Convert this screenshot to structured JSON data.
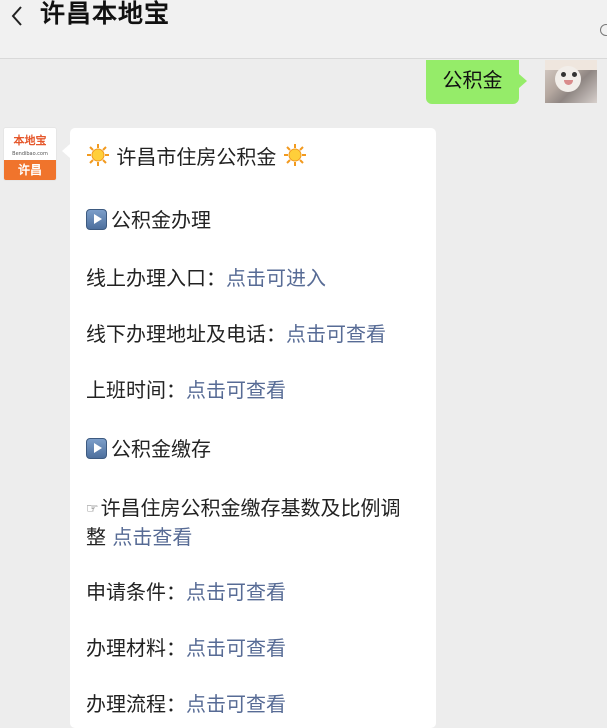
{
  "header": {
    "title": "许昌本地宝",
    "back_icon": "chevron-left-icon",
    "more_icon": "more-icon"
  },
  "outgoing": {
    "text": "公积金",
    "bubble_color": "#95ec69"
  },
  "bot": {
    "logo_name": "本地宝",
    "logo_url": "Bendibao.com",
    "logo_city": "许昌",
    "brand_color": "#f0742c"
  },
  "message": {
    "heading": "许昌市住房公积金",
    "section1_title": "公积金办理",
    "rows": [
      {
        "label": "线上办理入口：",
        "link": "点击可进入"
      },
      {
        "label": "线下办理地址及电话：",
        "link": "点击可查看"
      },
      {
        "label": "上班时间：",
        "link": "点击可查看"
      }
    ],
    "section2_title": "公积金缴存",
    "item_line1": "许昌住房公积金缴存基数及比例调",
    "item_line2": "整",
    "item_link": "点击查看",
    "rows2": [
      {
        "label": "申请条件：",
        "link": "点击可查看"
      },
      {
        "label": "办理材料：",
        "link": "点击可查看"
      },
      {
        "label": "办理流程：",
        "link": "点击可查看"
      }
    ],
    "link_color": "#576b95"
  }
}
